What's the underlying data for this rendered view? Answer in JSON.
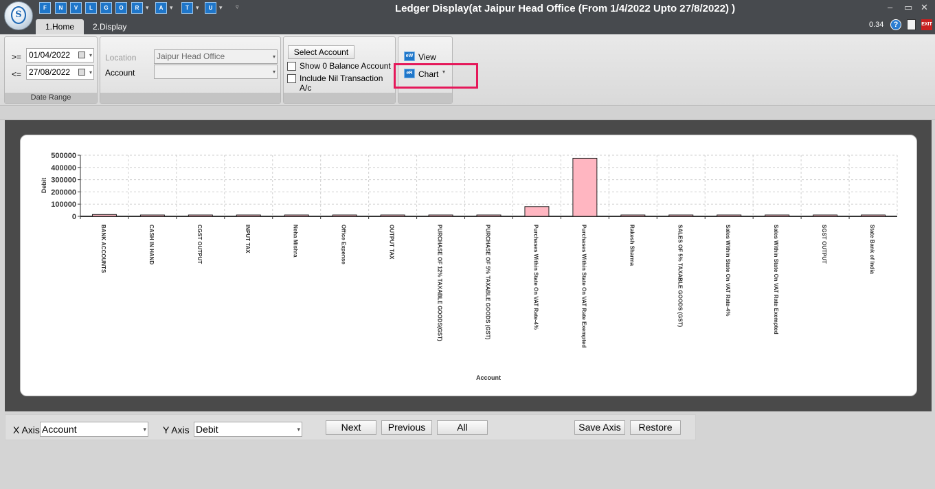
{
  "window": {
    "title": "Ledger Display(at Jaipur Head Office  (From 1/4/2022 Upto 27/8/2022) )",
    "quick_access": [
      "F",
      "N",
      "V",
      "L",
      "G",
      "O",
      "R",
      "A",
      "T",
      "U"
    ],
    "controls": {
      "minimize": "–",
      "maximize": "▭",
      "close": "✕"
    },
    "logo_letter": "S"
  },
  "ribbon_tabs": [
    "1.Home",
    "2.Display"
  ],
  "status": {
    "version": "0.34",
    "exit_label": "EXIT",
    "help": "?"
  },
  "date_range": {
    "from_op": ">=",
    "from_date": "01/04/2022",
    "to_op": "<=",
    "to_date": "27/08/2022",
    "group_label": "Date Range"
  },
  "location_group": {
    "location_label": "Location",
    "location_value": "Jaipur Head Office",
    "account_label": "Account",
    "account_value": ""
  },
  "account_group": {
    "select_button": "Select Account",
    "show_zero_label": "Show 0 Balance Account",
    "show_zero_checked": false,
    "include_nil_label": "Include Nil Transaction A/c",
    "include_nil_checked": false
  },
  "view_group": {
    "view_label": "View",
    "chart_label": "Chart",
    "view_icon": "eW",
    "chart_icon": "eR"
  },
  "chart_data": {
    "type": "bar",
    "title": "",
    "xlabel": "Account",
    "ylabel": "Debit",
    "ylim": [
      0,
      500000
    ],
    "yticks": [
      0,
      100000,
      200000,
      300000,
      400000,
      500000
    ],
    "grid": true,
    "bar_color": "#ffb6c1",
    "categories": [
      "BANK ACCOUNTS",
      "CASH IN HAND",
      "CGST OUTPUT",
      "INPUT TAX",
      "Neha Mishra",
      "Office Expense",
      "OUTPUT TAX",
      "PURCHASE OF 12% TAXABLE GOODS(GST)",
      "PURCHASE OF 5% TAXABLE GOODS (GST)",
      "Purchases Within State On VAT Rate-4%",
      "Purchases Within State On VAT Rate Exempted",
      "Rakesh Sharma",
      "SALES OF 5% TAXABLE GOODS (GST)",
      "Sales Within State On VAT Rate-4%",
      "Sales Within State On VAT Rate Exempted",
      "SGST OUTPUT",
      "State Bank of India"
    ],
    "values": [
      15000,
      500,
      500,
      5000,
      10000,
      500,
      500,
      10000,
      500,
      80000,
      475000,
      10000,
      500,
      500,
      500,
      500,
      500
    ]
  },
  "bottom": {
    "x_axis_label": "X Axis",
    "x_axis_value": "Account",
    "y_axis_label": "Y Axis",
    "y_axis_value": "Debit",
    "next": "Next",
    "previous": "Previous",
    "all": "All",
    "save_axis": "Save Axis",
    "restore": "Restore"
  }
}
